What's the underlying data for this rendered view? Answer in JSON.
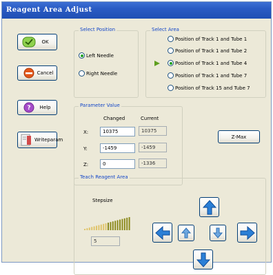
{
  "window": {
    "title": "Reagent Area Adjust"
  },
  "buttons": {
    "ok": "OK",
    "cancel": "Cancel",
    "help": "Help",
    "writeparam": "Writeparam",
    "zmax": "Z-Max"
  },
  "select_position": {
    "title": "Select Position",
    "options": [
      "Left Needle",
      "Right Needle"
    ],
    "selected": "Left Needle"
  },
  "select_area": {
    "title": "Select Area",
    "options": [
      "Position of Track 1 and Tube 1",
      "Position of Track 1 and Tube 2",
      "Position of Track 1 and Tube 4",
      "Position of Track 1 and Tube 7",
      "Position of Track 15 and Tube 7"
    ],
    "selected": "Position of Track 1 and Tube 4"
  },
  "parameter_value": {
    "title": "Parameter Value",
    "col_changed": "Changed",
    "col_current": "Current",
    "rows": [
      {
        "label": "X:",
        "changed": "10375",
        "current": "10375"
      },
      {
        "label": "Y:",
        "changed": "-1459",
        "current": "-1459"
      },
      {
        "label": "Z:",
        "changed": "0",
        "current": "-1336"
      }
    ]
  },
  "teach": {
    "title": "Teach Reagent Area",
    "stepsize_label": "Stepsize",
    "stepsize_value": "5",
    "stepsize_level": 0.5
  },
  "icons": {
    "ok": "checkmark-icon",
    "cancel": "minus-icon",
    "help": "question-icon",
    "writeparam": "write-icon",
    "arrows": [
      "arrow-up-icon",
      "arrow-left-icon",
      "arrow-up-small-icon",
      "arrow-down-small-icon",
      "arrow-right-icon",
      "arrow-down-icon"
    ]
  },
  "colors": {
    "title_bar": "#2a5bc4",
    "group_title": "#1447c8",
    "arrow_blue": "#2b7fd6",
    "selected_marker": "#5f9f1f"
  }
}
